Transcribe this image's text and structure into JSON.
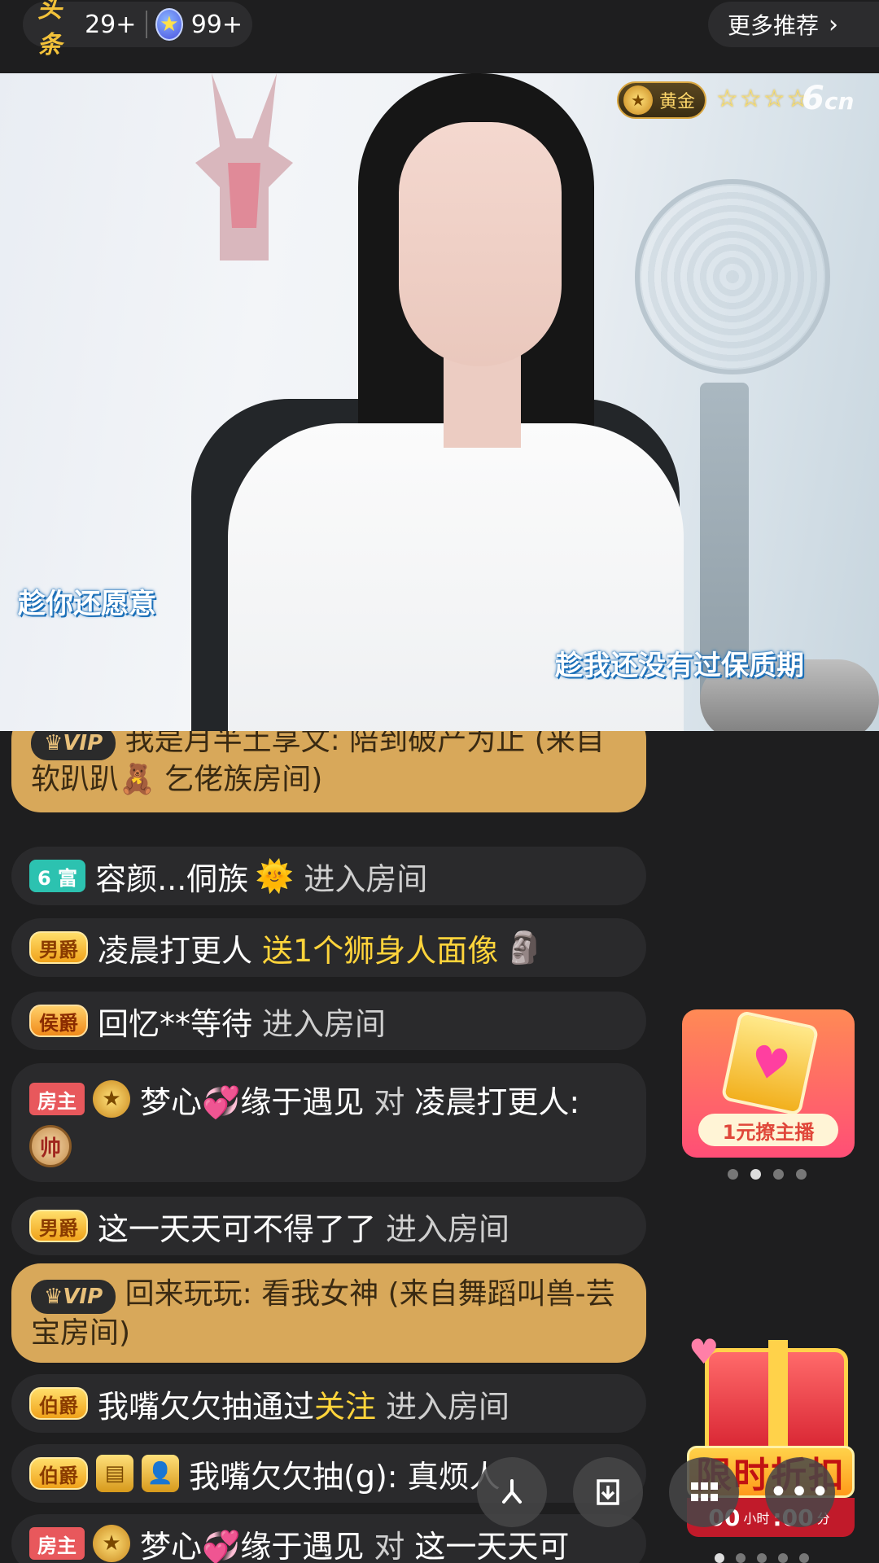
{
  "topbar": {
    "toutiao_label": "头条",
    "toutiao_count": "29+",
    "star_count": "99+",
    "more_label": "更多推荐"
  },
  "video": {
    "level_label": "黄金",
    "level_stars": "☆☆☆☆",
    "brand_logo": "6",
    "brand_suffix": "cn",
    "subtitle_left": "趁你还愿意",
    "subtitle_right": "趁我还没有过保质期"
  },
  "chat": {
    "messages": [
      {
        "badge": "VIP",
        "text": "我是月半土享文: 陪到破产为止 (来自软趴趴🧸 乞佬族房间)"
      },
      {
        "badge": "6 富",
        "name": "容颜...侗族",
        "icon": "🌞",
        "action": "进入房间"
      },
      {
        "badge": "男爵",
        "name": "凌晨打更人",
        "gift_text": "送1个狮身人面像",
        "icon": "🗿"
      },
      {
        "badge": "侯爵",
        "name": "回忆**等待",
        "action": "进入房间"
      },
      {
        "badge": "房主",
        "name": "梦心💞缘于遇见",
        "connector": "对",
        "target": "凌晨打更人:",
        "chess_char": "帅"
      },
      {
        "badge": "男爵",
        "name": "这一天天可不得了了",
        "action": "进入房间"
      },
      {
        "badge": "VIP",
        "text": "回来玩玩: 看我女神 (来自舞蹈叫兽-芸宝房间)"
      },
      {
        "badge": "伯爵",
        "name": "我嘴欠欠抽通过",
        "follow": "关注",
        "action": "进入房间"
      },
      {
        "badge": "伯爵",
        "name": "我嘴欠欠抽(g): 真烦人"
      },
      {
        "badge": "房主",
        "name": "梦心💞缘于遇见",
        "connector": "对",
        "target": "这一天天可"
      }
    ]
  },
  "promo": {
    "label": "1元撩主播",
    "card_icon": "heart-card-icon",
    "dots_total": 4,
    "dots_active": 2
  },
  "giftbox": {
    "banner": "限时折扣",
    "hours": "00",
    "hours_unit": "小时",
    "minutes": ":00",
    "minutes_unit": "分"
  },
  "fabs": [
    "share-icon",
    "download-icon",
    "grid-menu-icon",
    "more-icon"
  ],
  "colors": {
    "background": "#1e1e1f",
    "vip_bubble": "#d8a85a",
    "gold_text": "#ffd43b",
    "owner_badge": "#e8585c",
    "rich_badge": "#2cc2b0"
  }
}
